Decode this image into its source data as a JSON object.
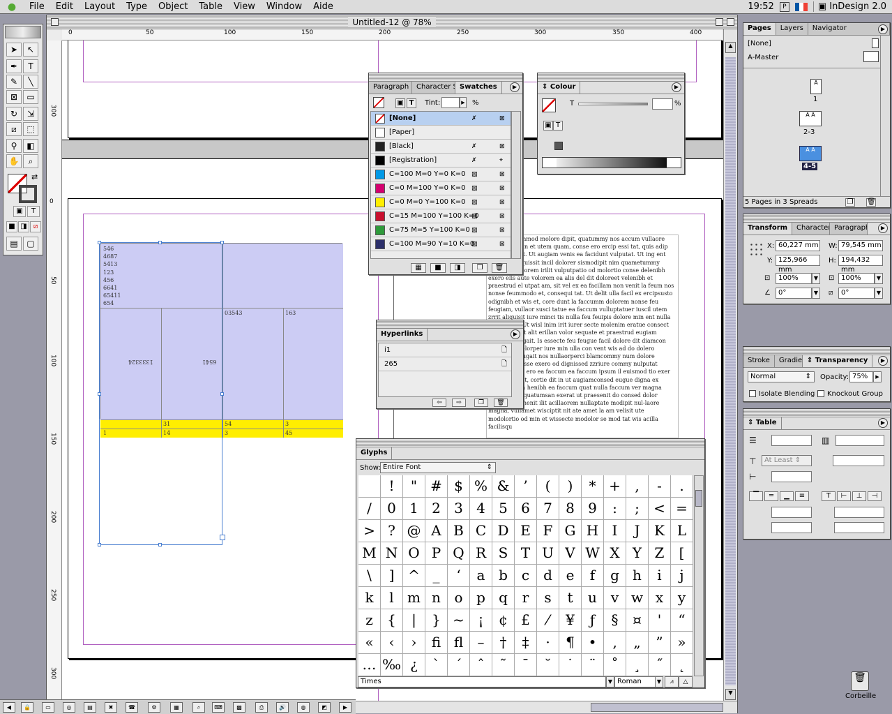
{
  "menubar": {
    "items": [
      "File",
      "Edit",
      "Layout",
      "Type",
      "Object",
      "Table",
      "View",
      "Window",
      "Aide"
    ],
    "clock": "19:52",
    "app_name": "InDesign 2.0"
  },
  "document": {
    "title": "Untitled-12 @ 78%",
    "ruler_h": [
      "0",
      "50",
      "100",
      "150",
      "200",
      "250",
      "300",
      "350",
      "400"
    ],
    "ruler_v": [
      "300",
      "0",
      "50",
      "100",
      "150",
      "200",
      "250",
      "300"
    ]
  },
  "table": {
    "first_cell_lines": [
      "546",
      "4687",
      "5413",
      "123",
      "456",
      "6641",
      "65411",
      "654"
    ],
    "row2": [
      "1333324",
      "6541",
      "03543",
      "163"
    ],
    "row3a": [
      "",
      "31",
      "54",
      "3"
    ],
    "row3b": [
      "1",
      "14",
      "3",
      "45"
    ]
  },
  "body_text": "t dignim nummod molore dipit, quatummy nos accum vullaore facinis exer in et utem quam, conse ero ercip essi tat, quis adip ercilis augait. Ut augiam venis ea facidunt vulputat. Ut ing ent non exer sequissit incil dolorer sismodipit nim quametummy nonullaptat lorem irilit vulputpatio od molortio conse delenibh exero elis aute volorem ea alis del dit doloreet velenibh et praestrud el utpat am, sit vel ex ea facillam non venit la feum nos nonse feummodo et, consequi tat. Ut delit ulla facil ex ercipsusto odignibh et wis et, core dunt la faccumm dolorem nonse feu feugiam, vullaor susci tatue ea faccum vulluptatuer iuscil utem zrrit aliquisit iure minci tis nulla feu feuipis dolore min ent nulla conulputat. Ut wisl inim irit iurer secte molenim eratue consect tuerat wisi ut alit erillan volor sequate et praestrud eugiam quamcon eugait. Is essecte feu feugue facil dolore dit diamcon etuercip eril-lorper iure min ulla con vent wis ad do dolero consequat eugait nos nullaorperci blamcommy num dolore dolorem dipisse exero od dignissed zzriure commy nulputat dolortie nibh ero ea faccum ea faccum ipsum il euismod tio exer magna augiat, cortie dit in ut augiamconsed eugue digna ex enisismodion henibh ea faccum quat nulla faccum ver magna facinim nim quatumsan exerat ut praesenit do consed dolor suscilla con henit ilit acillaorem nullaptate modipit nul-laore magna, vullamet wisciptit nit ate amet la am velisit ute modolortio od min et wissecte modolor se mod tat wis acilla facilisqu",
  "swatches_panel": {
    "tabs": [
      "Paragraph S",
      "Character S",
      "Swatches"
    ],
    "tint_label": "Tint:",
    "tint_unit": "%",
    "items": [
      {
        "name": "[None]",
        "color": "none"
      },
      {
        "name": "[Paper]",
        "color": "#ffffff"
      },
      {
        "name": "[Black]",
        "color": "#222222"
      },
      {
        "name": "[Registration]",
        "color": "#000000"
      },
      {
        "name": "C=100 M=0 Y=0 K=0",
        "color": "#0099e6"
      },
      {
        "name": "C=0 M=100 Y=0 K=0",
        "color": "#d4006f"
      },
      {
        "name": "C=0 M=0 Y=100 K=0",
        "color": "#ffee00"
      },
      {
        "name": "C=15 M=100 Y=100 K=0",
        "color": "#c8102e"
      },
      {
        "name": "C=75 M=5 Y=100 K=0",
        "color": "#2e9a3a"
      },
      {
        "name": "C=100 M=90 Y=10 K=0",
        "color": "#2c2f6a"
      }
    ]
  },
  "colour_panel": {
    "tab": "Colour",
    "t_label": "T",
    "unit": "%"
  },
  "hyperlinks_panel": {
    "tab": "Hyperlinks",
    "items": [
      "i1",
      "265"
    ]
  },
  "glyphs_panel": {
    "tab": "Glyphs",
    "show_label": "Show:",
    "show_value": "Entire Font",
    "font": "Times",
    "style": "Roman",
    "glyphs": [
      " ",
      "!",
      "\"",
      "#",
      "$",
      "%",
      "&",
      "’",
      "(",
      ")",
      "*",
      "+",
      ",",
      "-",
      ".",
      "/",
      "0",
      "1",
      "2",
      "3",
      "4",
      "5",
      "6",
      "7",
      "8",
      "9",
      ":",
      ";",
      "<",
      "=",
      ">",
      "?",
      "@",
      "A",
      "B",
      "C",
      "D",
      "E",
      "F",
      "G",
      "H",
      "I",
      "J",
      "K",
      "L",
      "M",
      "N",
      "O",
      "P",
      "Q",
      "R",
      "S",
      "T",
      "U",
      "V",
      "W",
      "X",
      "Y",
      "Z",
      "[",
      "\\",
      "]",
      "^",
      "_",
      "‘",
      "a",
      "b",
      "c",
      "d",
      "e",
      "f",
      "g",
      "h",
      "i",
      "j",
      "k",
      "l",
      "m",
      "n",
      "o",
      "p",
      "q",
      "r",
      "s",
      "t",
      "u",
      "v",
      "w",
      "x",
      "y",
      "z",
      "{",
      "|",
      "}",
      "~",
      "¡",
      "¢",
      "£",
      "⁄",
      "¥",
      "ƒ",
      "§",
      "¤",
      "'",
      "“",
      "«",
      "‹",
      "›",
      "ﬁ",
      "ﬂ",
      "–",
      "†",
      "‡",
      "·",
      "¶",
      "•",
      "‚",
      "„",
      "”",
      "»",
      "…",
      "‰",
      "¿",
      "`",
      "´",
      "ˆ",
      "˜",
      "¯",
      "˘",
      "˙",
      "¨",
      "˚",
      "¸",
      "˝",
      "˛"
    ]
  },
  "pages_panel": {
    "tabs": [
      "Pages",
      "Layers",
      "Navigator"
    ],
    "none_label": "[None]",
    "master_label": "A-Master",
    "spreads": [
      "1",
      "2-3",
      "4-5"
    ],
    "footer": "5 Pages in 3 Spreads"
  },
  "transform_panel": {
    "tabs": [
      "Transform",
      "Character",
      "Paragraph"
    ],
    "x_label": "X:",
    "x": "60,227 mm",
    "y_label": "Y:",
    "y": "125,966 mm",
    "w_label": "W:",
    "w": "79,545 mm",
    "h_label": "H:",
    "h": "194,432 mm",
    "scale_x": "100%",
    "scale_y": "100%",
    "rotate": "0°",
    "shear": "0°"
  },
  "transparency_panel": {
    "tabs": [
      "Stroke",
      "Gradient",
      "Transparency"
    ],
    "mode": "Normal",
    "opacity_label": "Opacity:",
    "opacity": "75%",
    "isolate": "Isolate Blending",
    "knockout": "Knockout Group"
  },
  "table_panel": {
    "tab": "Table",
    "row_height_mode": "At Least"
  },
  "desktop": {
    "trash_label": "Corbeille"
  }
}
